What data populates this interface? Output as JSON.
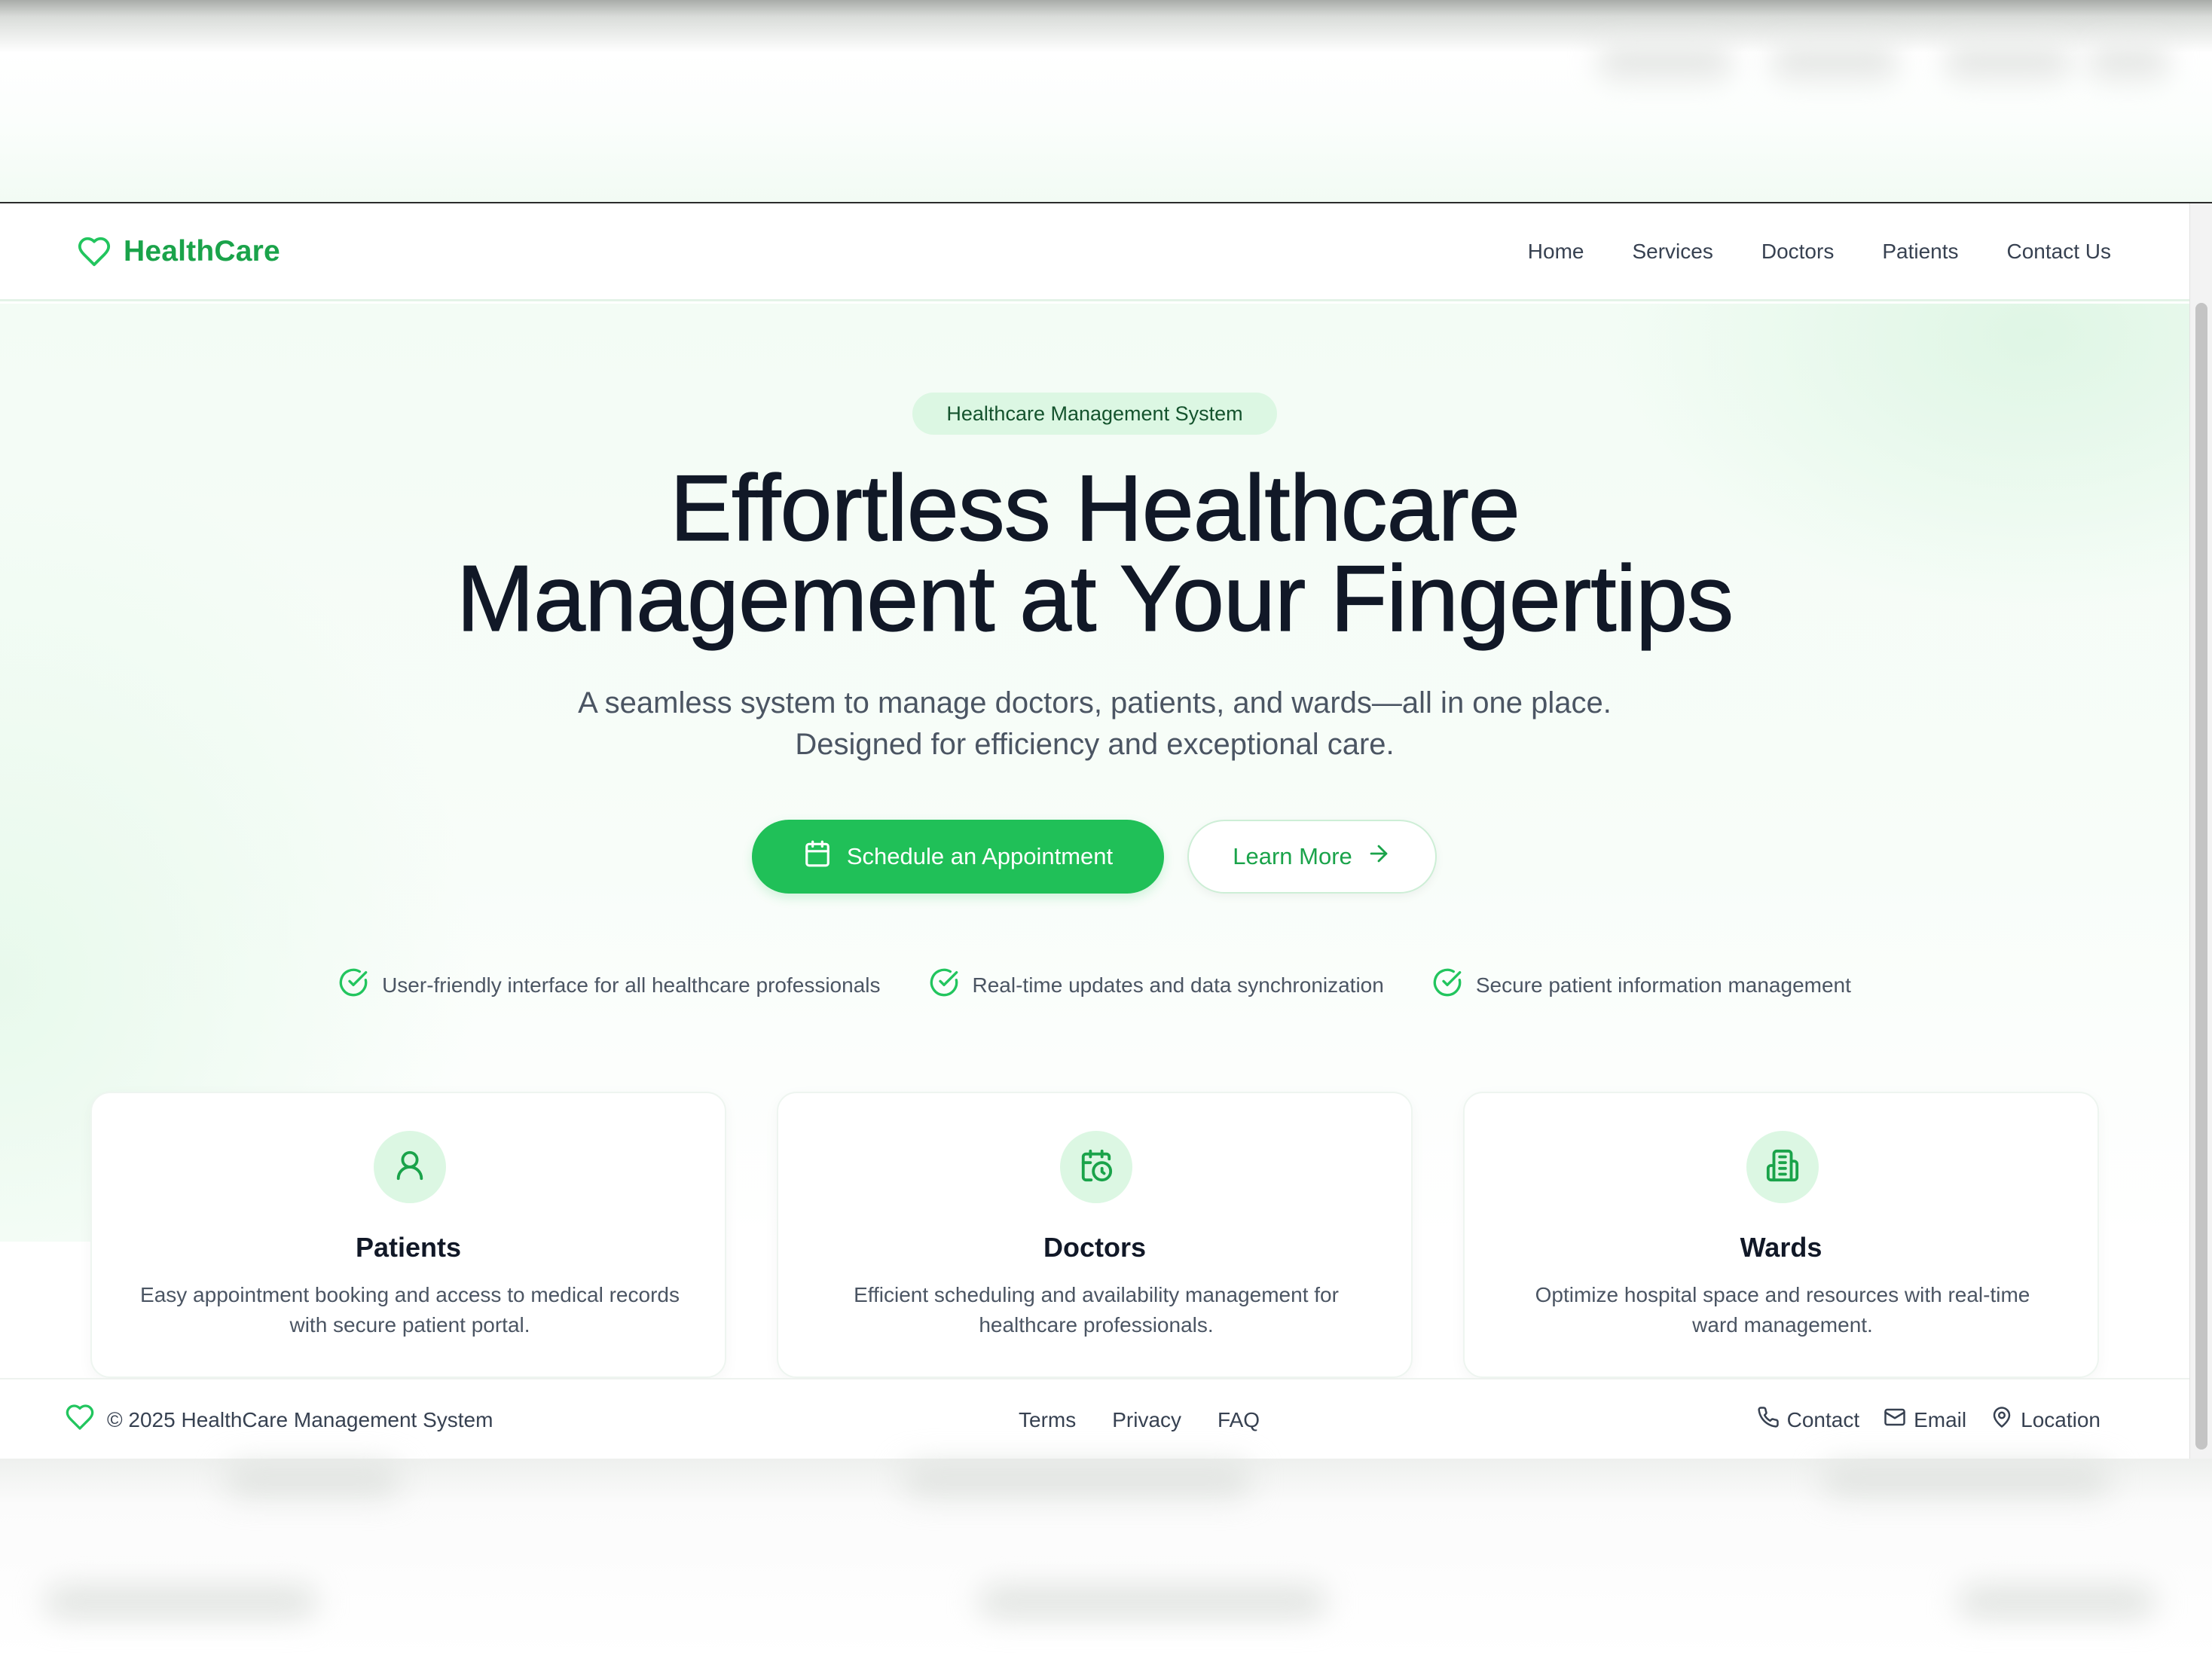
{
  "brand": {
    "name": "HealthCare",
    "icon": "heart-icon",
    "color": "#1aa34a"
  },
  "nav": {
    "links": [
      "Home",
      "Services",
      "Doctors",
      "Patients",
      "Contact Us"
    ]
  },
  "hero": {
    "badge": "Healthcare Management System",
    "headline_line1": "Effortless Healthcare",
    "headline_line2": "Management at Your Fingertips",
    "subtext": "A seamless system to manage doctors, patients, and wards—all in one place. Designed for efficiency and exceptional care.",
    "primary_button": {
      "label": "Schedule an Appointment",
      "icon": "calendar-icon"
    },
    "secondary_button": {
      "label": "Learn More",
      "icon": "arrow-right-icon"
    }
  },
  "features": [
    {
      "text": "User-friendly interface for all healthcare professionals",
      "icon": "check-circle-icon"
    },
    {
      "text": "Real-time updates and data synchronization",
      "icon": "check-circle-icon"
    },
    {
      "text": "Secure patient information management",
      "icon": "check-circle-icon"
    }
  ],
  "cards": [
    {
      "title": "Patients",
      "description": "Easy appointment booking and access to medical records with secure patient portal.",
      "icon": "user-icon"
    },
    {
      "title": "Doctors",
      "description": "Efficient scheduling and availability management for healthcare professionals.",
      "icon": "calendar-clock-icon"
    },
    {
      "title": "Wards",
      "description": "Optimize hospital space and resources with real-time ward management.",
      "icon": "building-icon"
    }
  ],
  "footer": {
    "copyright": "© 2025 HealthCare Management System",
    "links": [
      "Terms",
      "Privacy",
      "FAQ"
    ],
    "contact": [
      {
        "label": "Contact",
        "icon": "phone-icon"
      },
      {
        "label": "Email",
        "icon": "mail-icon"
      },
      {
        "label": "Location",
        "icon": "map-pin-icon"
      }
    ]
  },
  "colors": {
    "accent": "#20c058",
    "accent_dark": "#1aa34a",
    "badge_bg": "#dcf7e3",
    "text_dark": "#111827",
    "text_muted": "#4b5563"
  }
}
